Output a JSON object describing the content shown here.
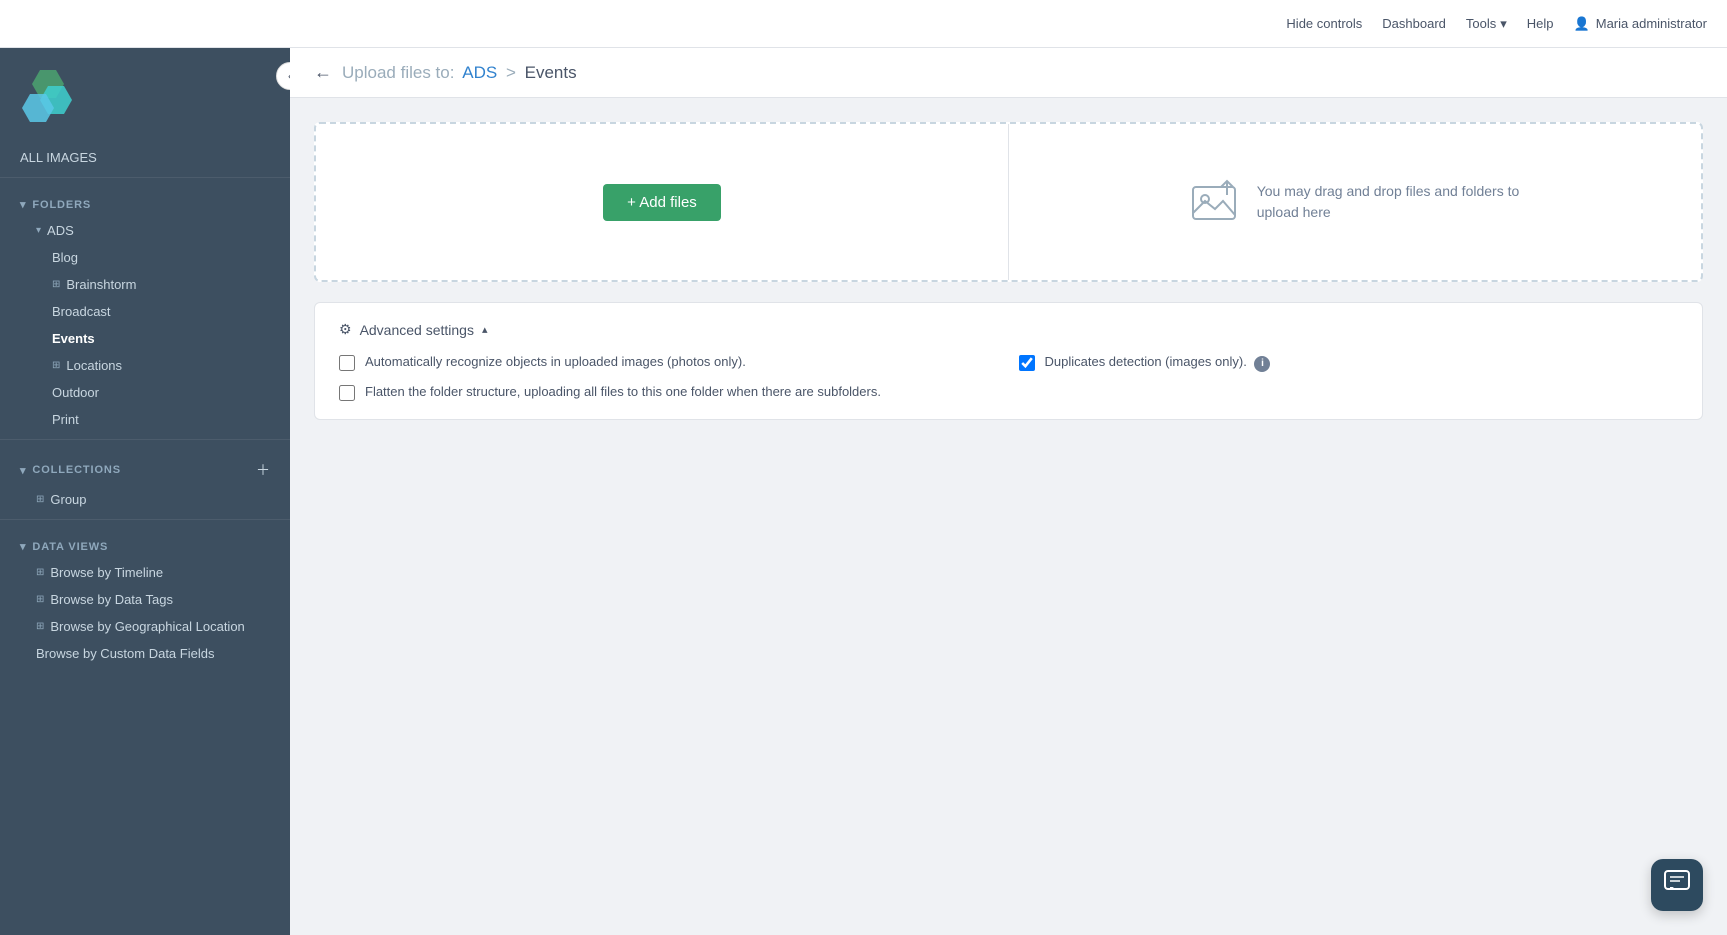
{
  "topbar": {
    "hide_controls": "Hide controls",
    "dashboard": "Dashboard",
    "tools": "Tools",
    "help": "Help",
    "user": "Maria administrator"
  },
  "sidebar": {
    "all_images": "ALL IMAGES",
    "folders_label": "FOLDERS",
    "collapse_btn": "‹",
    "folders": {
      "ads": "ADS",
      "blog": "Blog",
      "brainshtorm": "Brainshtorm",
      "broadcast": "Broadcast",
      "events": "Events",
      "locations": "Locations",
      "outdoor": "Outdoor",
      "print": "Print"
    },
    "collections_label": "COLLECTIONS",
    "collections": {
      "group": "Group"
    },
    "data_views_label": "DATA VIEWS",
    "data_views": {
      "browse_timeline": "Browse by Timeline",
      "browse_data_tags": "Browse by Data Tags",
      "browse_geo": "Browse by Geographical Location",
      "browse_custom": "Browse by Custom Data Fields"
    }
  },
  "page_header": {
    "back_icon": "←",
    "upload_label": "Upload files to:",
    "path_ads": "ADS",
    "separator": ">",
    "path_events": "Events"
  },
  "upload": {
    "add_files_btn": "+ Add files",
    "drag_drop_line1": "You may drag and drop files and folders to",
    "drag_drop_line2": "upload here"
  },
  "advanced": {
    "label": "Advanced settings",
    "gear": "⚙",
    "chevron": "▴",
    "checkbox1_label": "Automatically recognize objects in uploaded images (photos only).",
    "checkbox1_checked": false,
    "checkbox2_label": "Duplicates detection (images only).",
    "checkbox2_checked": true,
    "checkbox3_label": "Flatten the folder structure, uploading all files to this one folder when there are subfolders.",
    "checkbox3_checked": false,
    "info_icon": "i"
  },
  "chat_btn": "💬"
}
